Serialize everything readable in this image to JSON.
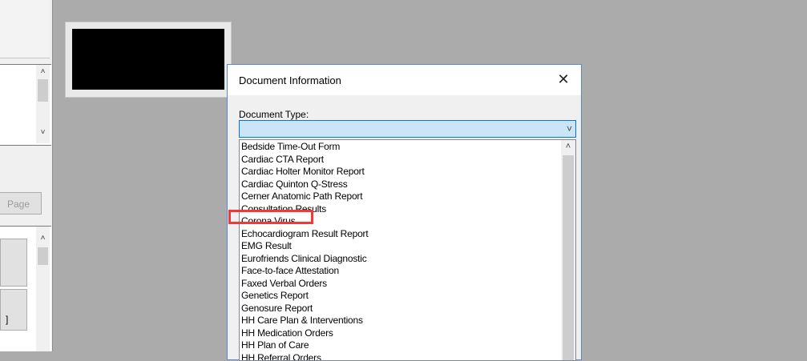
{
  "left_panel": {
    "page_button_label": "Page",
    "mini_button_label": "]"
  },
  "dialog": {
    "title": "Document Information",
    "close_label": "✕",
    "document_type_label": "Document Type:",
    "document_type_value": "",
    "list_items": [
      "Bedside Time-Out Form",
      "Cardiac CTA Report",
      "Cardiac Holter Monitor Report",
      "Cardiac Quinton Q-Stress",
      "Cerner Anatomic Path Report",
      "Consultation Results",
      "Corona Virus",
      "Echocardiogram Result Report",
      "EMG Result",
      "Eurofriends Clinical Diagnostic",
      "Face-to-face Attestation",
      "Faxed Verbal Orders",
      "Genetics Report",
      "Genosure Report",
      "HH Care Plan & Interventions",
      "HH Medication Orders",
      "HH Plan of Care",
      "HH Referral Orders"
    ]
  },
  "highlight": {
    "color": "#ee3a3a",
    "target": "Corona Virus"
  },
  "colors": {
    "workspace_bg": "#ababab",
    "select_bg": "#cce4f7",
    "select_border": "#0078d7"
  }
}
